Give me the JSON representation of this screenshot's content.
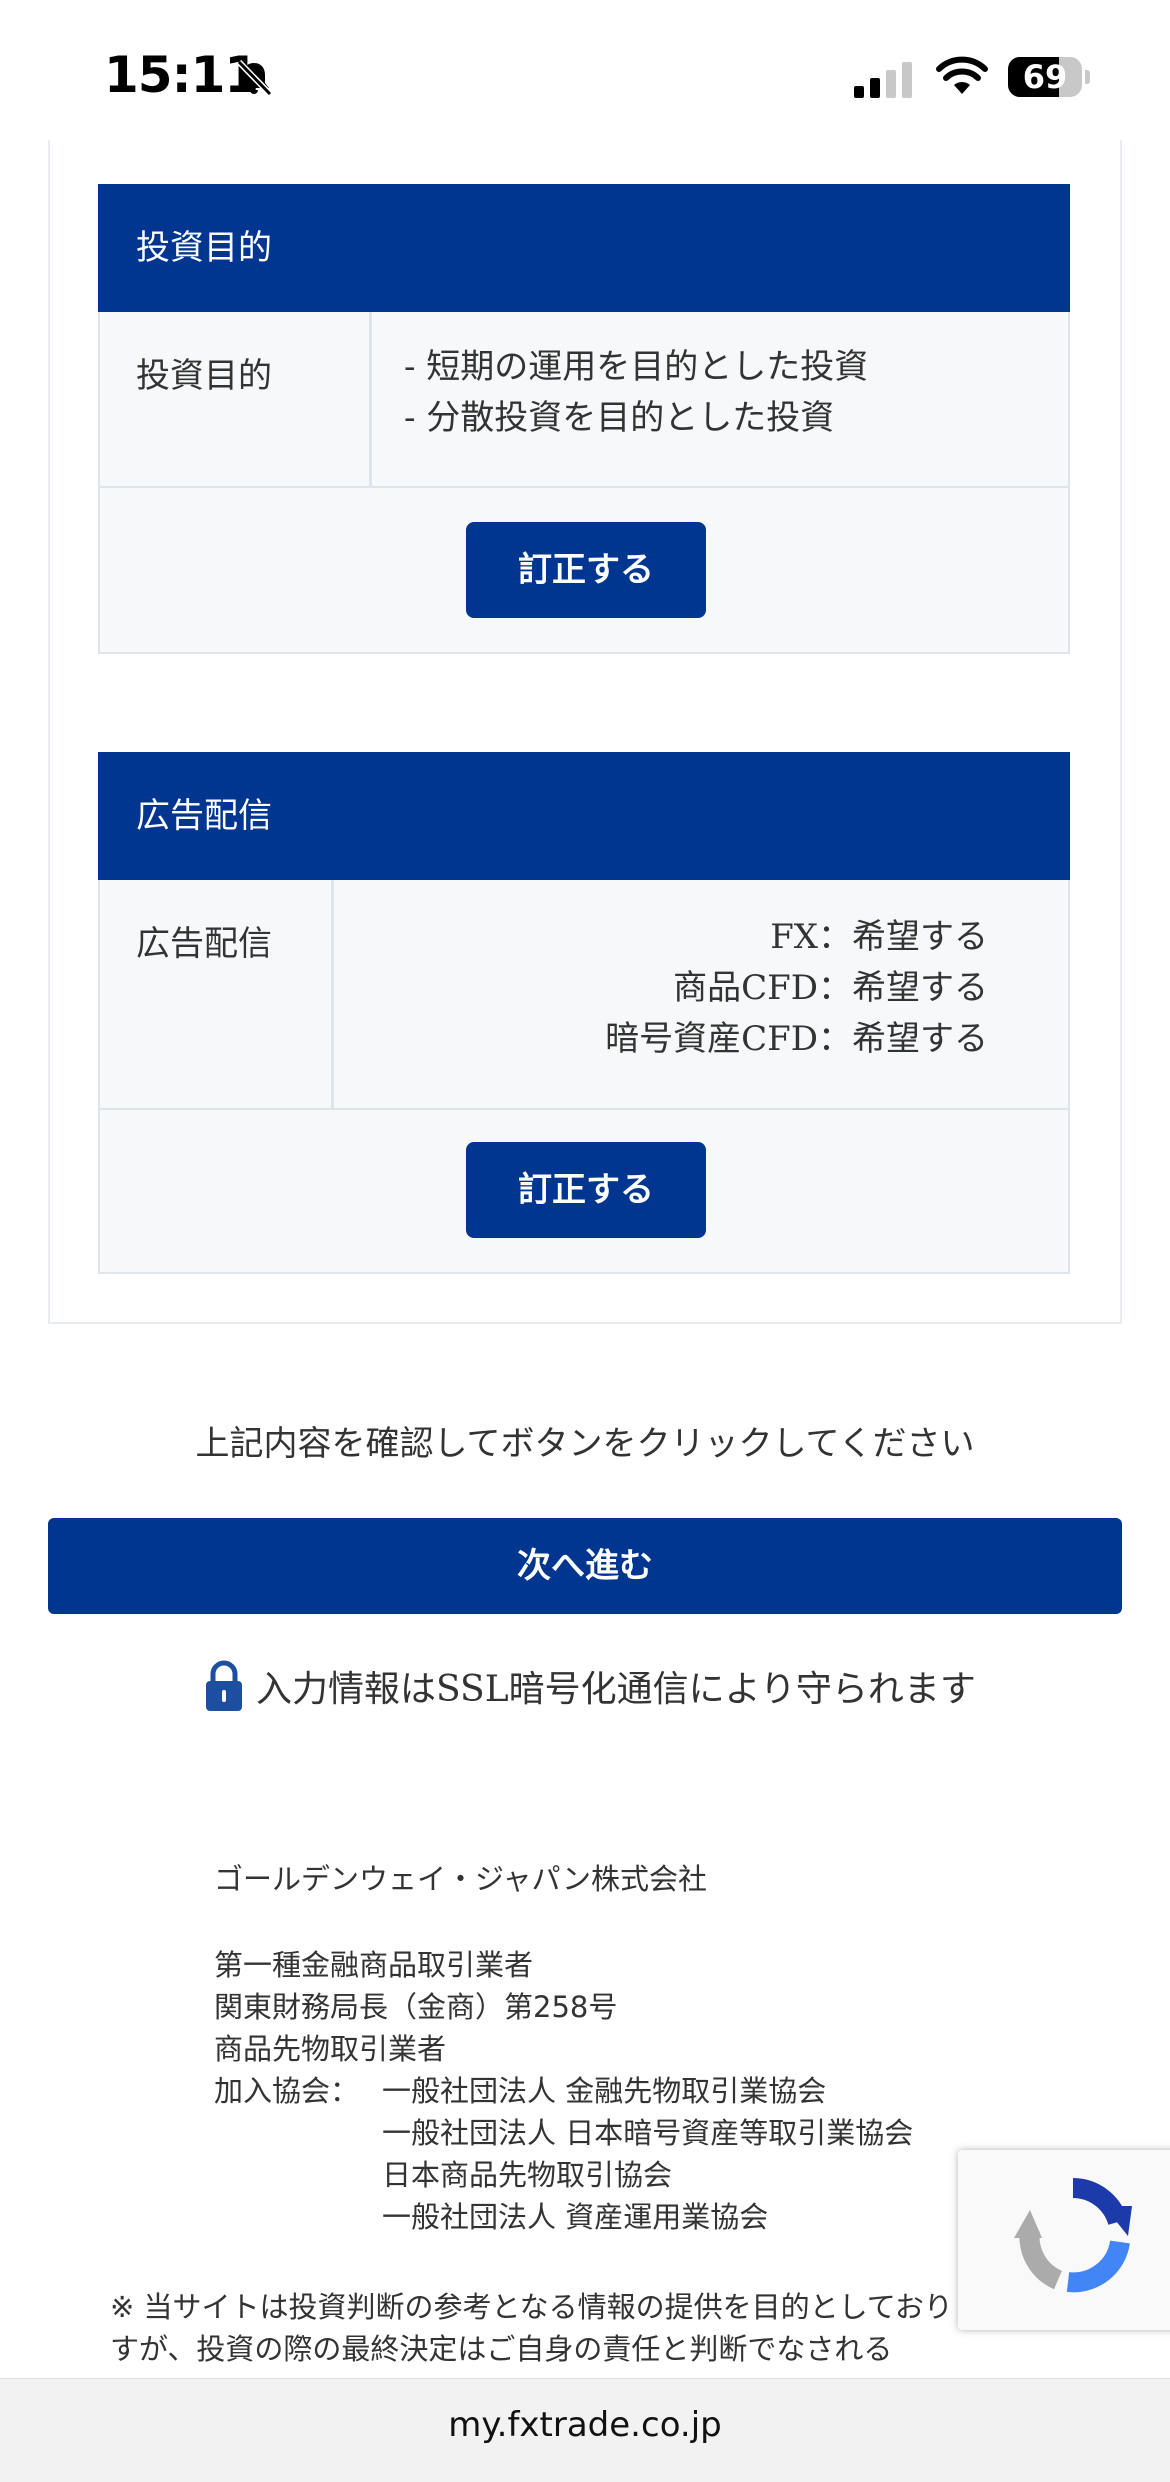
{
  "status_bar": {
    "time": "15:11",
    "battery": "69",
    "battery_level": 0.69
  },
  "sections": {
    "investment": {
      "header": "投資目的",
      "row_label": "投資目的",
      "values": [
        "- 短期の運用を目的とした投資",
        "- 分散投資を目的とした投資"
      ],
      "button": "訂正する"
    },
    "ads": {
      "header": "広告配信",
      "row_label": "広告配信",
      "values": [
        "FX：希望する",
        "商品CFD：希望する",
        "暗号資産CFD：希望する"
      ],
      "button": "訂正する"
    }
  },
  "confirm_notice": "上記内容を確認してボタンをクリックしてください",
  "next_button": "次へ進む",
  "ssl_notice": "入力情報はSSL暗号化通信により守られます",
  "footer": {
    "company": "ゴールデンウェイ・ジャパン株式会社",
    "registrations": [
      "第一種金融商品取引業者",
      "関東財務局長（金商）第258号",
      "商品先物取引業者"
    ],
    "member_label": "加入協会：",
    "associations": [
      "一般社団法人 金融先物取引業協会",
      "一般社団法人 日本暗号資産等取引業協会",
      "日本商品先物取引協会",
      "一般社団法人 資産運用業協会"
    ],
    "disclaimer": "※ 当サイトは投資判断の参考となる情報の提供を目的としておりますが、投資の際の最終決定はご自身の責任と判断でなされる"
  },
  "url": "my.fxtrade.co.jp",
  "colors": {
    "primary": "#003690",
    "border": "#dde4ec",
    "panel_bg": "#f6f8fa"
  },
  "icons": [
    "bell-slash-icon",
    "cellular-signal-icon",
    "wifi-icon",
    "battery-icon",
    "lock-icon",
    "recaptcha-icon"
  ]
}
